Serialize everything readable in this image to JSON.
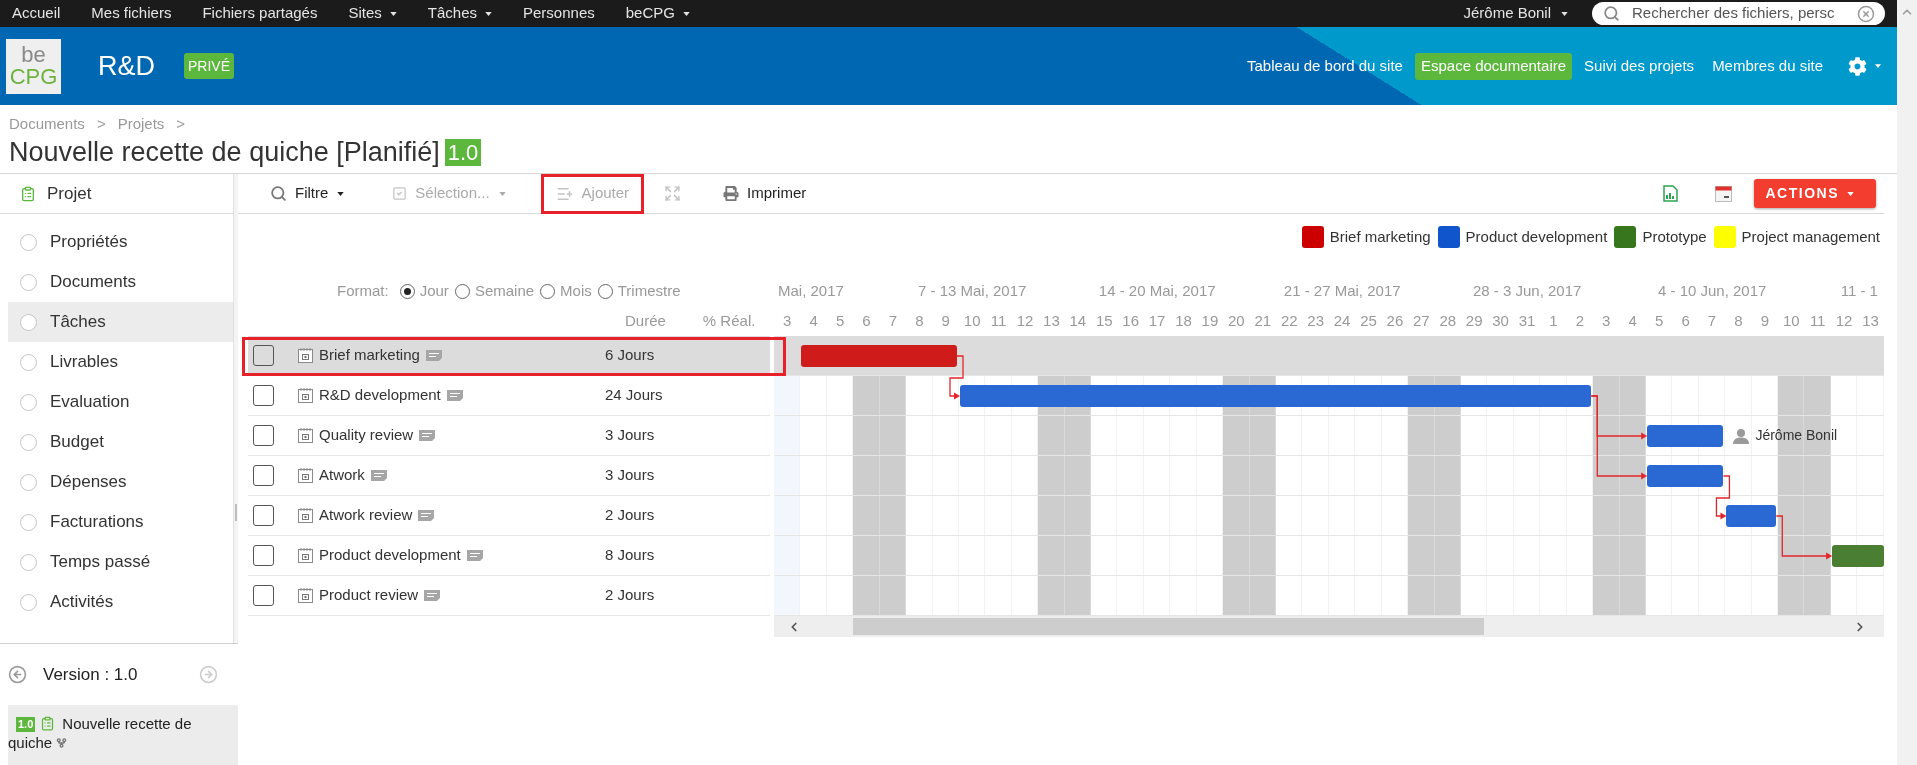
{
  "top_nav": {
    "items": [
      {
        "label": "Accueil",
        "dropdown": false
      },
      {
        "label": "Mes fichiers",
        "dropdown": false
      },
      {
        "label": "Fichiers partagés",
        "dropdown": false
      },
      {
        "label": "Sites",
        "dropdown": true
      },
      {
        "label": "Tâches",
        "dropdown": true
      },
      {
        "label": "Personnes",
        "dropdown": false
      },
      {
        "label": "beCPG",
        "dropdown": true
      }
    ],
    "user": {
      "label": "Jérôme Bonil",
      "dropdown": true
    },
    "search": {
      "placeholder": "Rechercher des fichiers, persc"
    }
  },
  "site_header": {
    "logo": {
      "line_1": "be",
      "line_2": "CPG"
    },
    "title": "R&D",
    "badge": "PRIVÉ",
    "nav": [
      {
        "label": "Tableau de bord du site",
        "selected": false
      },
      {
        "label": "Espace documentaire",
        "selected": true
      },
      {
        "label": "Suivi des projets",
        "selected": false
      },
      {
        "label": "Membres du site",
        "selected": false
      }
    ],
    "settings": {
      "dropdown": true
    }
  },
  "breadcrumb": [
    {
      "label": "Documents",
      "separator": ">"
    },
    {
      "label": "Projets",
      "separator": ">"
    }
  ],
  "page_title": {
    "text": "Nouvelle recette de quiche [Planifié]",
    "version": "1.0"
  },
  "sidebar": {
    "title": "Projet",
    "items": [
      {
        "label": "Propriétés",
        "selected": false
      },
      {
        "label": "Documents",
        "selected": false
      },
      {
        "label": "Tâches",
        "selected": true
      },
      {
        "label": "Livrables",
        "selected": false
      },
      {
        "label": "Evaluation",
        "selected": false
      },
      {
        "label": "Budget",
        "selected": false
      },
      {
        "label": "Dépenses",
        "selected": false
      },
      {
        "label": "Facturations",
        "selected": false
      },
      {
        "label": "Temps passé",
        "selected": false
      },
      {
        "label": "Activités",
        "selected": false
      }
    ],
    "version": {
      "label": "Version : 1.0",
      "previous_disabled": false,
      "next_disabled": true
    },
    "current": {
      "version": "1.0",
      "name": "Nouvelle recette de quiche"
    }
  },
  "toolbar": {
    "items": [
      {
        "kind": "filter",
        "label": "Filtre",
        "dropdown": true,
        "disabled": false,
        "annotated": false
      },
      {
        "kind": "selection",
        "label": "Sélection...",
        "dropdown": true,
        "disabled": true,
        "annotated": false
      },
      {
        "kind": "add",
        "label": "Ajouter",
        "dropdown": false,
        "disabled": true,
        "annotated": true
      },
      {
        "kind": "fullscreen",
        "dropdown": false,
        "disabled": true,
        "annotated": false
      },
      {
        "kind": "print",
        "label": "Imprimer",
        "dropdown": false,
        "disabled": false,
        "annotated": false
      }
    ],
    "tools": [
      {
        "kind": "export"
      },
      {
        "kind": "calendar"
      }
    ],
    "actions": {
      "label": "ACTIONS",
      "dropdown": true
    }
  },
  "legend": [
    {
      "label": "Brief marketing",
      "color": "#cc0000"
    },
    {
      "label": "Product development",
      "color": "#1155cc"
    },
    {
      "label": "Prototype",
      "color": "#38761d"
    },
    {
      "label": "Project management",
      "color": "#ffff00"
    }
  ],
  "gantt": {
    "format": {
      "label": "Format:",
      "options": [
        {
          "label": "Jour",
          "selected": true
        },
        {
          "label": "Semaine",
          "selected": false
        },
        {
          "label": "Mois",
          "selected": false
        },
        {
          "label": "Trimestre",
          "selected": false
        }
      ]
    },
    "columns": {
      "duration": "Durée",
      "progress": "% Réal."
    },
    "weeks": [
      {
        "label": "Mai, 2017"
      },
      {
        "label": "7 - 13 Mai, 2017"
      },
      {
        "label": "14 - 20 Mai, 2017"
      },
      {
        "label": "21 - 27 Mai, 2017"
      },
      {
        "label": "28 - 3 Jun, 2017"
      },
      {
        "label": "4 - 10 Jun, 2017"
      },
      {
        "label": "11 - 1"
      }
    ],
    "days": [
      {
        "label": "3",
        "weekend": false,
        "today": true
      },
      {
        "label": "4",
        "weekend": false,
        "today": false
      },
      {
        "label": "5",
        "weekend": false,
        "today": false
      },
      {
        "label": "6",
        "weekend": true,
        "today": false
      },
      {
        "label": "7",
        "weekend": true,
        "today": false
      },
      {
        "label": "8",
        "weekend": false,
        "today": false
      },
      {
        "label": "9",
        "weekend": false,
        "today": false
      },
      {
        "label": "10",
        "weekend": false,
        "today": false
      },
      {
        "label": "11",
        "weekend": false,
        "today": false
      },
      {
        "label": "12",
        "weekend": false,
        "today": false
      },
      {
        "label": "13",
        "weekend": true,
        "today": false
      },
      {
        "label": "14",
        "weekend": true,
        "today": false
      },
      {
        "label": "15",
        "weekend": false,
        "today": false
      },
      {
        "label": "16",
        "weekend": false,
        "today": false
      },
      {
        "label": "17",
        "weekend": false,
        "today": false
      },
      {
        "label": "18",
        "weekend": false,
        "today": false
      },
      {
        "label": "19",
        "weekend": false,
        "today": false
      },
      {
        "label": "20",
        "weekend": true,
        "today": false
      },
      {
        "label": "21",
        "weekend": true,
        "today": false
      },
      {
        "label": "22",
        "weekend": false,
        "today": false
      },
      {
        "label": "23",
        "weekend": false,
        "today": false
      },
      {
        "label": "24",
        "weekend": false,
        "today": false
      },
      {
        "label": "25",
        "weekend": false,
        "today": false
      },
      {
        "label": "26",
        "weekend": false,
        "today": false
      },
      {
        "label": "27",
        "weekend": true,
        "today": false
      },
      {
        "label": "28",
        "weekend": true,
        "today": false
      },
      {
        "label": "29",
        "weekend": false,
        "today": false
      },
      {
        "label": "30",
        "weekend": false,
        "today": false
      },
      {
        "label": "31",
        "weekend": false,
        "today": false
      },
      {
        "label": "1",
        "weekend": false,
        "today": false
      },
      {
        "label": "2",
        "weekend": false,
        "today": false
      },
      {
        "label": "3",
        "weekend": true,
        "today": false
      },
      {
        "label": "4",
        "weekend": true,
        "today": false
      },
      {
        "label": "5",
        "weekend": false,
        "today": false
      },
      {
        "label": "6",
        "weekend": false,
        "today": false
      },
      {
        "label": "7",
        "weekend": false,
        "today": false
      },
      {
        "label": "8",
        "weekend": false,
        "today": false
      },
      {
        "label": "9",
        "weekend": false,
        "today": false
      },
      {
        "label": "10",
        "weekend": true,
        "today": false
      },
      {
        "label": "11",
        "weekend": true,
        "today": false
      },
      {
        "label": "12",
        "weekend": false,
        "today": false
      },
      {
        "label": "13",
        "weekend": false,
        "today": false
      }
    ]
  },
  "tasks": [
    {
      "name": "Brief marketing",
      "duration": "6 Jours",
      "selected": true,
      "annotated": true,
      "checked": false,
      "bar": {
        "color": "#d01b1b"
      }
    },
    {
      "name": "R&D development",
      "duration": "24 Jours",
      "selected": false,
      "annotated": false,
      "checked": false,
      "bar": {
        "color": "#2a69d3"
      }
    },
    {
      "name": "Quality review",
      "duration": "3 Jours",
      "selected": false,
      "annotated": false,
      "checked": false,
      "bar": {
        "color": "#2a69d3"
      },
      "assignee": "Jérôme Bonil"
    },
    {
      "name": "Atwork",
      "duration": "3 Jours",
      "selected": false,
      "annotated": false,
      "checked": false,
      "bar": {
        "color": "#2a69d3"
      }
    },
    {
      "name": "Atwork review",
      "duration": "2 Jours",
      "selected": false,
      "annotated": false,
      "checked": false,
      "bar": {
        "color": "#2a69d3"
      }
    },
    {
      "name": "Product development",
      "duration": "8 Jours",
      "selected": false,
      "annotated": false,
      "checked": false,
      "bar": {
        "color": "#4a7e32"
      }
    },
    {
      "name": "Product review",
      "duration": "2 Jours",
      "selected": false,
      "annotated": false,
      "checked": false
    }
  ]
}
